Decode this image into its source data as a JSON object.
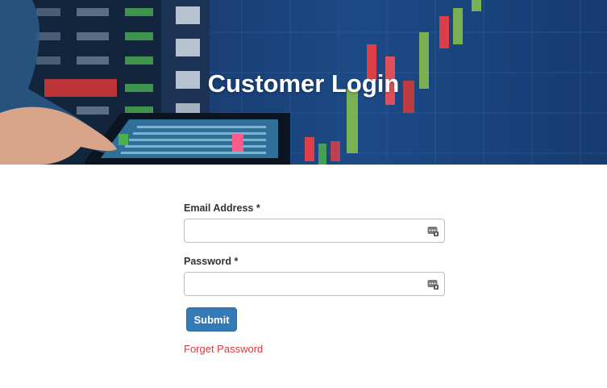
{
  "hero": {
    "title": "Customer Login"
  },
  "form": {
    "email_label": "Email Address *",
    "email_value": "",
    "password_label": "Password *",
    "password_value": "",
    "submit_label": "Submit",
    "forget_label": "Forget Password"
  },
  "colors": {
    "submit_bg": "#337ab7",
    "link": "#d9383a",
    "hero_bg": "#1a3f74"
  },
  "icons": [
    "password-manager-icon"
  ]
}
